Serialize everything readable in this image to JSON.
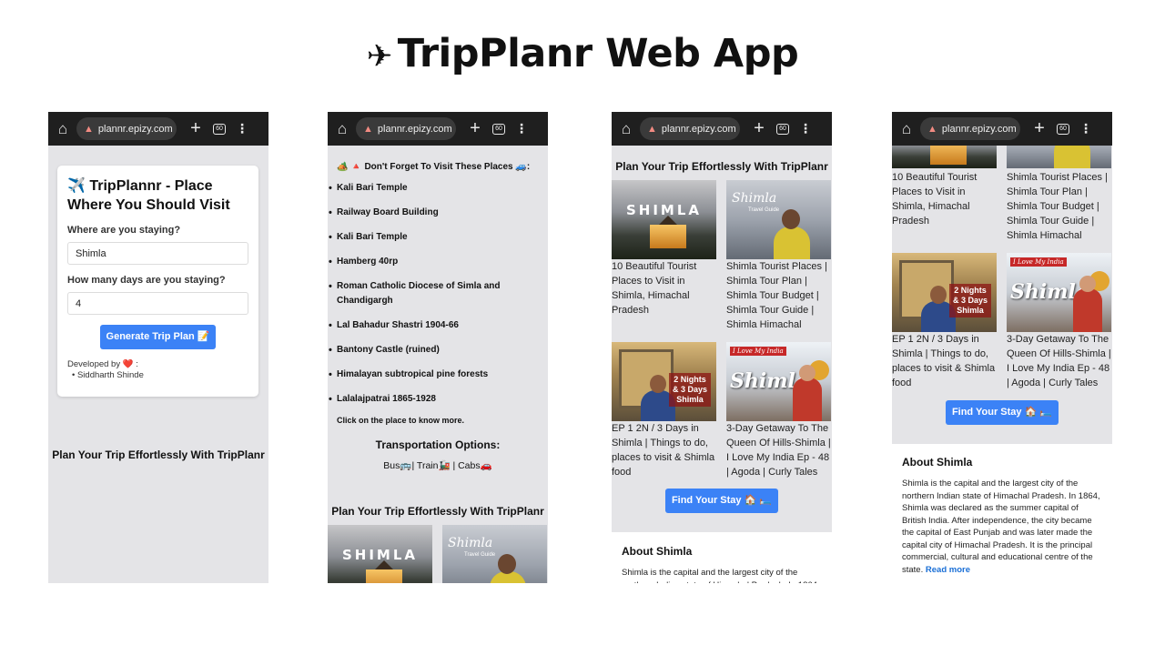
{
  "page_title": {
    "icon": "✈",
    "text": "TripPlanr  Web App"
  },
  "browser": {
    "url": "plannr.epizy.com",
    "tabs_count": "60"
  },
  "phone1": {
    "card_title": "✈️ TripPlannr - Place Where You Should Visit",
    "staying_label": "Where are you staying?",
    "staying_value": "Shimla",
    "days_label": "How many days are you staying?",
    "days_value": "4",
    "generate_button": "Generate Trip Plan 📝",
    "developed_by": "Developed by ❤️ :",
    "developer": "Siddharth Shinde",
    "tagline": "Plan Your Trip Effortlessly With TripPlanr"
  },
  "phone2": {
    "visit_heading": "🏕️ 🔺 Don't Forget To Visit These Places 🚙:",
    "places": [
      "Kali Bari Temple",
      "Railway Board Building",
      "Kali Bari Temple",
      "Hamberg 40rp",
      "Roman Catholic Diocese of Simla and Chandigargh",
      "Lal Bahadur Shastri 1904-66",
      "Bantony Castle (ruined)",
      "Himalayan subtropical pine forests",
      "Lalalajpatrai 1865-1928"
    ],
    "click_note": "Click on the place to know more.",
    "transport_heading": "Transportation Options:",
    "transport_value": "Bus🚌| Train🚂 | Cabs🚗",
    "tagline": "Plan Your Trip Effortlessly With TripPlanr"
  },
  "videos": [
    {
      "thumb_text": "SHIMLA",
      "caption": "10 Beautiful Tourist Places to Visit in Shimla, Himachal Pradesh"
    },
    {
      "thumb_text": "Shimla",
      "thumb_sub": "Travel Guide",
      "caption": "Shimla Tourist Places | Shimla Tour Plan | Shimla Tour Budget | Shimla Tour Guide | Shimla Himachal"
    },
    {
      "thumb_text": "2 Nights & 3 Days Shimla",
      "caption": "EP 1 2N / 3 Days in Shimla | Things to do, places to visit & Shimla food"
    },
    {
      "thumb_tag": "I Love My India",
      "thumb_text": "Shimla",
      "caption": "3-Day Getaway To The Queen Of Hills-Shimla | I Love My India Ep - 48 | Agoda | Curly Tales"
    }
  ],
  "phone3": {
    "heading": "Plan Your Trip Effortlessly With TripPlanr",
    "stay_button": "Find Your Stay 🏠 🛏️"
  },
  "about": {
    "heading": "About Shimla",
    "short_text": "Shimla is the capital and the largest city of the northern Indian state of Himachal Pradesh. In 1864",
    "full_text": "Shimla is the capital and the largest city of the northern Indian state of Himachal Pradesh. In 1864, Shimla was declared as the summer capital of British India. After independence, the city became the capital of East Punjab and was later made the capital city of Himachal Pradesh. It is the principal commercial, cultural and educational centre of the state.",
    "read_more": "Read more"
  },
  "phone4": {
    "cap0_partial": "10 Beautiful Tourist Places to Visit in Shimla, Himachal Pradesh",
    "cap1_partial": "Shimla Tourist Places | Shimla Tour Plan | Shimla Tour Budget | Shimla Tour Guide | Shimla Himachal",
    "stay_button": "Find Your Stay 🏠 🛏️"
  }
}
